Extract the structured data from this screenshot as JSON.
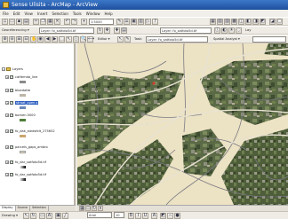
{
  "window": {
    "title": "Sense Ulisita - ArcMap - ArcView"
  },
  "menu": [
    "File",
    "Edit",
    "View",
    "Insert",
    "Selection",
    "Tools",
    "Window",
    "Help"
  ],
  "toolbars": {
    "georeferencing_label": "Georeferencing ▾",
    "layer_combo": "Layer: fo_satfoto5d.tif",
    "layer_combo2": "Layer: fo_satfoto5d.tif",
    "spatial_analyst_label": "Spatial Analyst ▾",
    "georef_combo": "Layer: fo_satfoto5d.tif",
    "editor_label": "Editor ▾",
    "task_label": "Task:",
    "zoom_value": "1:5000"
  },
  "toc": {
    "root_label": "Layers",
    "layers": [
      {
        "label": "catfemda_line"
      },
      {
        "label": "bloedatte"
      },
      {
        "label": "straat_open.s",
        "selected": true
      },
      {
        "label": "bomen.5000"
      },
      {
        "label": "fo_dak_stedsfelt_275652"
      },
      {
        "label": "parcels_gaps_ambro"
      },
      {
        "label": "fo_dar_satfoto5d.tif"
      },
      {
        "label": "fo_dar_satfoto5d.tif"
      }
    ],
    "tabs": [
      "Display",
      "Source",
      "Selection"
    ]
  },
  "drawing": {
    "label": "Drawing ▾",
    "font": "Arial",
    "size": "10"
  }
}
